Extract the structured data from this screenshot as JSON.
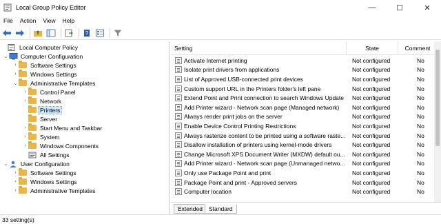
{
  "window": {
    "title": "Local Group Policy Editor",
    "minimize": "—",
    "maximize": "☐",
    "close": "✕"
  },
  "menu": [
    "File",
    "Action",
    "View",
    "Help"
  ],
  "tree": {
    "items": [
      {
        "label": "Local Computer Policy",
        "icon": "computer-icon",
        "toggle": ""
      },
      {
        "label": "Computer Configuration",
        "icon": "computer-config-icon",
        "toggle": "⌄"
      },
      {
        "label": "Software Settings",
        "icon": "folder-icon",
        "toggle": "›"
      },
      {
        "label": "Windows Settings",
        "icon": "folder-icon",
        "toggle": "›"
      },
      {
        "label": "Administrative Templates",
        "icon": "folder-icon",
        "toggle": "⌄"
      },
      {
        "label": "Control Panel",
        "icon": "folder-icon",
        "toggle": "›"
      },
      {
        "label": "Network",
        "icon": "folder-icon",
        "toggle": "›"
      },
      {
        "label": "Printers",
        "icon": "folder-icon",
        "toggle": ""
      },
      {
        "label": "Server",
        "icon": "folder-icon",
        "toggle": ""
      },
      {
        "label": "Start Menu and Taskbar",
        "icon": "folder-icon",
        "toggle": "›"
      },
      {
        "label": "System",
        "icon": "folder-icon",
        "toggle": "›"
      },
      {
        "label": "Windows Components",
        "icon": "folder-icon",
        "toggle": "›"
      },
      {
        "label": "All Settings",
        "icon": "folder-icon",
        "toggle": ""
      },
      {
        "label": "User Configuration",
        "icon": "user-config-icon",
        "toggle": "⌄"
      },
      {
        "label": "Software Settings",
        "icon": "folder-icon",
        "toggle": "›"
      },
      {
        "label": "Windows Settings",
        "icon": "folder-icon",
        "toggle": "›"
      },
      {
        "label": "Administrative Templates",
        "icon": "folder-icon",
        "toggle": "›"
      }
    ],
    "selected_index": 7
  },
  "list": {
    "columns": {
      "setting": "Setting",
      "state": "State",
      "comment": "Comment"
    },
    "rows": [
      {
        "setting": "Activate Internet printing",
        "state": "Not configured",
        "comment": "No"
      },
      {
        "setting": "Isolate print drivers from applications",
        "state": "Not configured",
        "comment": "No"
      },
      {
        "setting": "List of Approved USB-connected print devices",
        "state": "Not configured",
        "comment": "No"
      },
      {
        "setting": "Custom support URL in the Printers folder's left pane",
        "state": "Not configured",
        "comment": "No"
      },
      {
        "setting": "Extend Point and Print connection to search Windows Update",
        "state": "Not configured",
        "comment": "No"
      },
      {
        "setting": "Add Printer wizard - Network scan page (Managed network)",
        "state": "Not configured",
        "comment": "No"
      },
      {
        "setting": "Always render print jobs on the server",
        "state": "Not configured",
        "comment": "No"
      },
      {
        "setting": "Enable Device Control Printing Restrictions",
        "state": "Not configured",
        "comment": "No"
      },
      {
        "setting": "Always rasterize content to be printed using a software raste...",
        "state": "Not configured",
        "comment": "No"
      },
      {
        "setting": "Disallow installation of printers using kernel-mode drivers",
        "state": "Not configured",
        "comment": "No"
      },
      {
        "setting": "Change Microsoft XPS Document Writer (MXDW) default ou...",
        "state": "Not configured",
        "comment": "No"
      },
      {
        "setting": "Add Printer wizard - Network scan page (Unmanaged netwo...",
        "state": "Not configured",
        "comment": "No"
      },
      {
        "setting": "Only use Package Point and print",
        "state": "Not configured",
        "comment": "No"
      },
      {
        "setting": "Package Point and print - Approved servers",
        "state": "Not configured",
        "comment": "No"
      },
      {
        "setting": "Computer location",
        "state": "Not configured",
        "comment": "No"
      }
    ]
  },
  "tabs": [
    {
      "label": "Extended",
      "active": false
    },
    {
      "label": "Standard",
      "active": true
    }
  ],
  "status": {
    "text": "33 setting(s)"
  },
  "colors": {
    "selection": "#cce8ff",
    "folder": "#e8b64a"
  }
}
